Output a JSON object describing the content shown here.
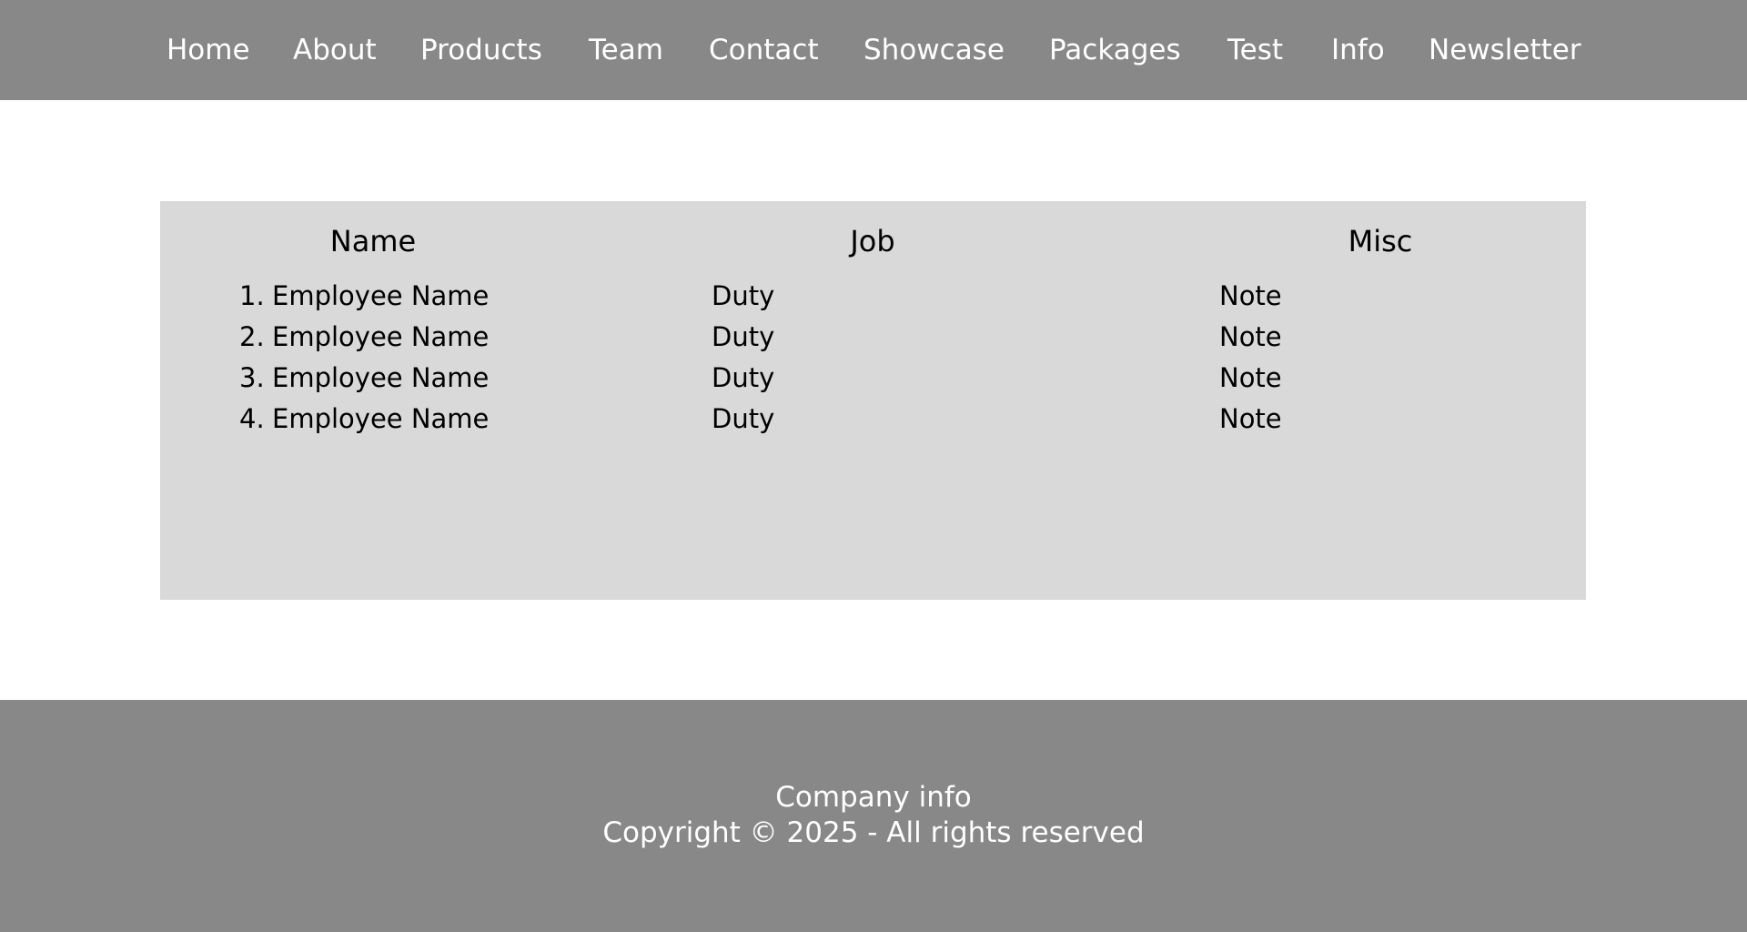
{
  "nav": {
    "items": [
      "Home",
      "About",
      "Products",
      "Team",
      "Contact",
      "Showcase",
      "Packages",
      "Test",
      "Info",
      "Newsletter"
    ]
  },
  "table": {
    "headers": [
      "Name",
      "Job",
      "Misc"
    ],
    "rows": [
      {
        "num": "1.",
        "name": "Employee Name",
        "job": "Duty",
        "misc": "Note"
      },
      {
        "num": "2.",
        "name": "Employee Name",
        "job": "Duty",
        "misc": "Note"
      },
      {
        "num": "3.",
        "name": "Employee Name",
        "job": "Duty",
        "misc": "Note"
      },
      {
        "num": "4.",
        "name": "Employee Name",
        "job": "Duty",
        "misc": "Note"
      }
    ]
  },
  "footer": {
    "company": "Company info",
    "copyright": "Copyright © 2025 - All rights reserved"
  },
  "colors": {
    "nav_bg": "#888888",
    "panel_bg": "#d9d9d9",
    "footer_bg": "#888888"
  }
}
